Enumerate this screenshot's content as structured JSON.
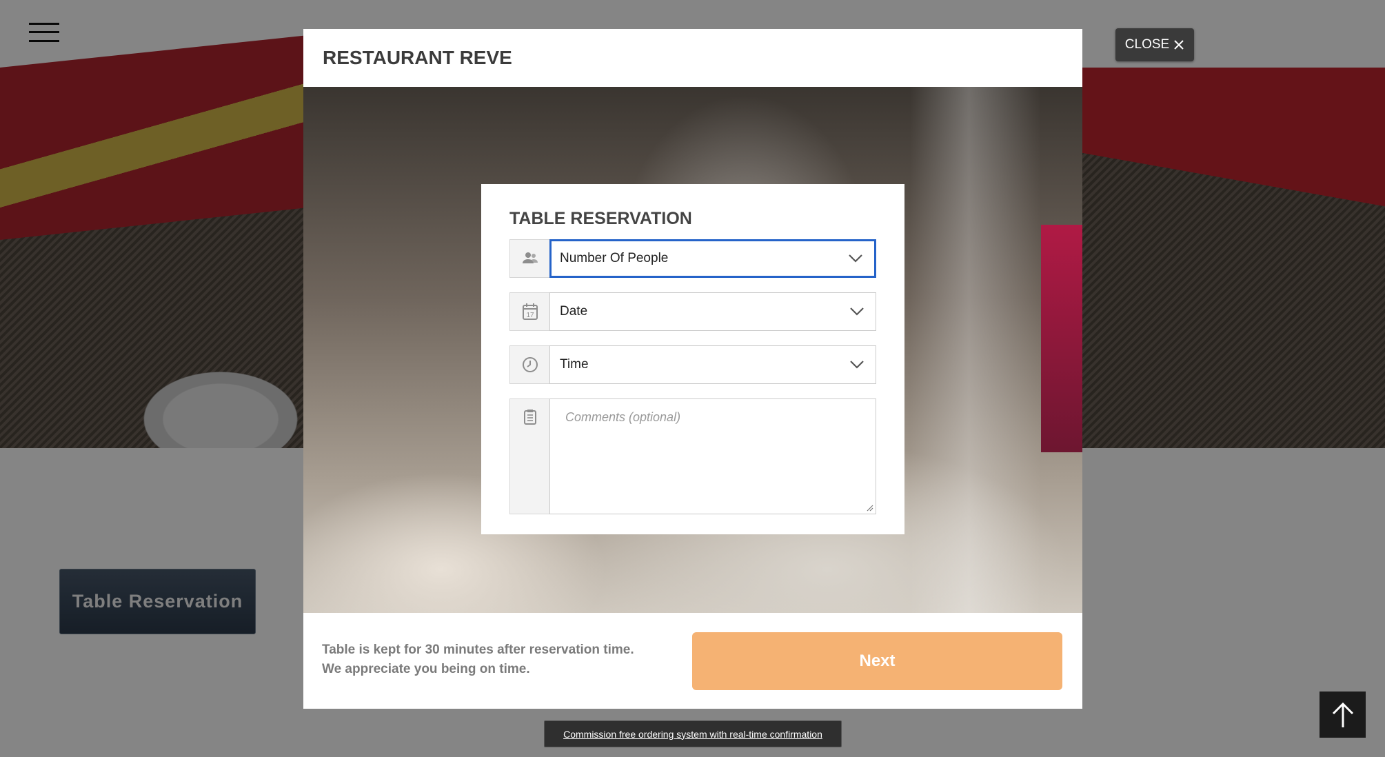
{
  "background": {
    "reserve_button_label": "Table Reservation"
  },
  "modal": {
    "title": "RESTAURANT REVE",
    "close_label": "CLOSE",
    "card": {
      "title": "TABLE RESERVATION",
      "people_select": {
        "value": "Number Of People",
        "icon": "people-icon"
      },
      "date_select": {
        "value": "Date",
        "icon": "calendar-icon",
        "calendar_day": "17"
      },
      "time_select": {
        "value": "Time",
        "icon": "clock-icon"
      },
      "comments": {
        "placeholder": "Comments (optional)",
        "icon": "notepad-icon"
      }
    },
    "footer": {
      "note_line1": "Table is kept for 30 minutes after reservation time.",
      "note_line2": "We appreciate you being on time.",
      "next_label": "Next"
    }
  },
  "bottom": {
    "commission_link": "Commission free ordering system with real-time confirmation"
  },
  "colors": {
    "accent_next": "#f5b273",
    "focus_border": "#2563c9",
    "close_bg": "#3a3a3a"
  }
}
